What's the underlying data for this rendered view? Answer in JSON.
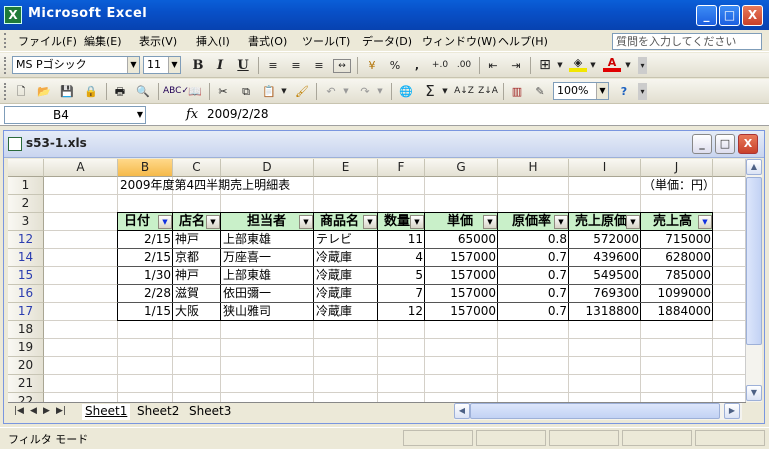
{
  "app": {
    "title": "Microsoft Excel",
    "icon_name": "excel-app-icon"
  },
  "window_buttons": {
    "minimize": "_",
    "maximize": "□",
    "close": "X"
  },
  "menu": {
    "items": [
      "ファイル(F)",
      "編集(E)",
      "表示(V)",
      "挿入(I)",
      "書式(O)",
      "ツール(T)",
      "データ(D)",
      "ウィンドウ(W)",
      "ヘルプ(H)"
    ],
    "help_placeholder": "質問を入力してください"
  },
  "format_toolbar": {
    "font": "MS Pゴシック",
    "size": "11",
    "bold": "B",
    "italic": "I",
    "underline": "U",
    "percent": "%",
    "comma": ",",
    "inc_decimal": "+.0",
    "dec_decimal": ".00"
  },
  "standard_toolbar": {
    "zoom": "100%",
    "sigma": "Σ",
    "sort_asc": "A↓Z",
    "sort_desc": "Z↓A"
  },
  "formula_bar": {
    "cell_ref": "B4",
    "fx": "fx",
    "value": "2009/2/28"
  },
  "workbook": {
    "title": "s53-1.xls"
  },
  "grid": {
    "columns": [
      "A",
      "B",
      "C",
      "D",
      "E",
      "F",
      "G",
      "H",
      "I",
      "J"
    ],
    "selected_column": "B",
    "rows": [
      "1",
      "2",
      "3",
      "12",
      "14",
      "15",
      "16",
      "17",
      "18",
      "19",
      "20",
      "21",
      "22"
    ],
    "title_cell": "2009年度第4四半期売上明細表",
    "unit_cell": "（単価：円）",
    "headers": [
      "日付",
      "店名",
      "担当者",
      "商品名",
      "数量",
      "単価",
      "原価率",
      "売上原価",
      "売上高"
    ],
    "data": [
      [
        "2/15",
        "神戸",
        "上部東雄",
        "テレビ",
        "11",
        "65000",
        "0.8",
        "572000",
        "715000"
      ],
      [
        "2/15",
        "京都",
        "万座喜一",
        "冷蔵庫",
        "4",
        "157000",
        "0.7",
        "439600",
        "628000"
      ],
      [
        "1/30",
        "神戸",
        "上部東雄",
        "冷蔵庫",
        "5",
        "157000",
        "0.7",
        "549500",
        "785000"
      ],
      [
        "2/28",
        "滋賀",
        "依田彌一",
        "冷蔵庫",
        "7",
        "157000",
        "0.7",
        "769300",
        "1099000"
      ],
      [
        "1/15",
        "大阪",
        "狭山雅司",
        "冷蔵庫",
        "12",
        "157000",
        "0.7",
        "1318800",
        "1884000"
      ]
    ]
  },
  "sheets": [
    "Sheet1",
    "Sheet2",
    "Sheet3"
  ],
  "active_sheet": "Sheet1",
  "status": {
    "text": "フィルタ モード"
  }
}
